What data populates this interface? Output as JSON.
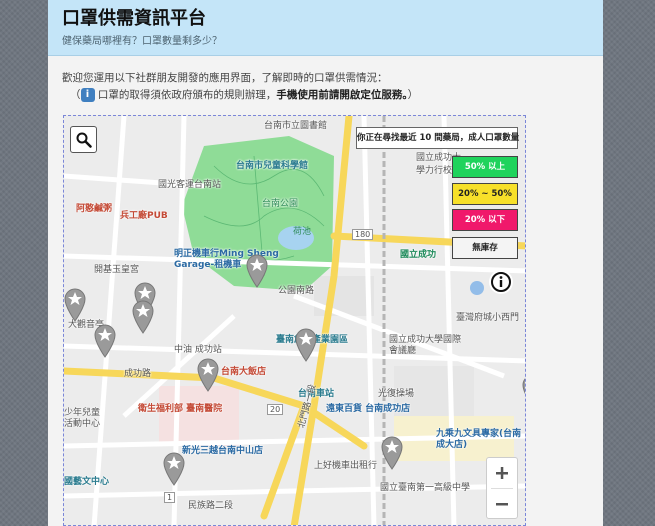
{
  "header": {
    "title": "口罩供需資訊平台",
    "subtitle": "健保藥局哪裡有？口罩數量剩多少？"
  },
  "intro": {
    "line1": "歡迎您運用以下社群朋友開發的應用界面，了解即時的口罩供需情況：",
    "line2_open": "（",
    "info_glyph": "i",
    "line2_text": " 口罩的取得須依政府頒布的規則辦理，",
    "line2_bold": "手機使用前請開啟定位服務。",
    "line2_close": "）"
  },
  "map": {
    "legend_title": "你正在尋找最近 10 間藥局，成人口罩數量",
    "legend_buttons": {
      "high": "50% 以上",
      "mid": "20% ~ 50%",
      "low": "20% 以下",
      "none": "無庫存"
    },
    "colors": {
      "high": "#1fd35c",
      "mid": "#f7e02a",
      "low": "#f0186b",
      "none": "#f4f4f4",
      "park": "#8fdc97",
      "road_yellow": "#f7d75a"
    },
    "icons": {
      "search": "magnifier-icon",
      "info": "info-circle-icon",
      "zoom_in": "plus-icon",
      "zoom_out": "minus-icon",
      "pharmacy": "gray-star-pin-icon"
    },
    "labels": {
      "city_library": "台南市立圖書館",
      "childrens_museum": "台南市兒童科學館",
      "kuo_kuang_bus": "國光客運台南站",
      "a_hsiu": "阿憨鹹粥",
      "bing_gong": "兵工廠PUB",
      "tainan_park": "台南公園",
      "lotus_pond": "荷池",
      "cheng_kung_univ_force": "國立成功大學力行校區",
      "ming_sheng": "明正機車行Ming Sheng Garage-租機車",
      "kai_yu": "開基玉皇宮",
      "park_road": "公園南路",
      "ncku": "國立成功大學",
      "ncku_near": "國立成功",
      "ta_kuan": "大觀音亭",
      "tainan_creative": "臺南創意產業園區",
      "zhongshan_chenggong": "中油 成功站",
      "tainan_hotel": "台南大飯店",
      "ncku_conf": "國立成功大學國際會議廳",
      "tainan_small_west": "臺灣府城小西門",
      "chenggong_rd": "成功路",
      "tainan_station": "台南車站",
      "guangfu_square": "光復操場",
      "health_hospital": "衛生福利部 臺南醫院",
      "far_eastern": "遠東百貨 台南成功店",
      "shin_kong": "新光三越台南中山店",
      "jiuyi_books": "九乘九文具專家(台南成大店)",
      "shanglu": "上好機車出租行",
      "tainan_first_hs": "國立臺南第一高級中學",
      "children_center": "少年兒童活動中心",
      "culture_center": "國藝文中心",
      "minzu_rd": "民族路二段",
      "beimen_rd": "北門路一段",
      "road_180": "180",
      "road_20": "20",
      "road_1": "1"
    }
  }
}
